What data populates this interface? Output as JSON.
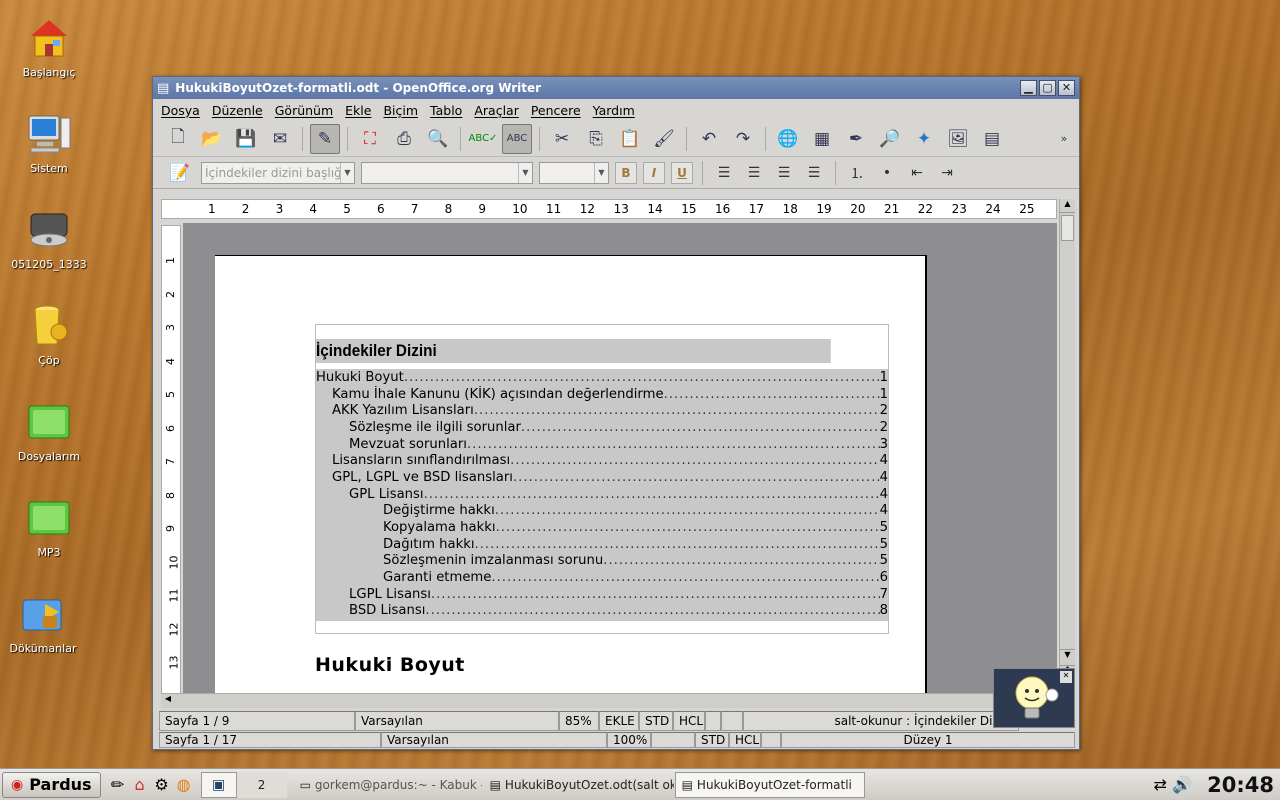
{
  "desktop": {
    "icons": [
      {
        "label": "Başlangıç"
      },
      {
        "label": "Sistem"
      },
      {
        "label": "051205_1333"
      },
      {
        "label": "Çöp"
      },
      {
        "label": "Dosyalarım"
      },
      {
        "label": "MP3"
      },
      {
        "label": "Dökümanlar"
      }
    ]
  },
  "window": {
    "title": "HukukiBoyutOzet-formatli.odt - OpenOffice.org Writer",
    "controls": {
      "minimize": "▁",
      "maximize": "▢",
      "close": "✕"
    }
  },
  "menu": [
    "Dosya",
    "Düzenle",
    "Görünüm",
    "Ekle",
    "Biçim",
    "Tablo",
    "Araçlar",
    "Pencere",
    "Yardım"
  ],
  "format_toolbar": {
    "style_value": "İçindekiler dizini başlığı",
    "bold": "B",
    "italic": "I",
    "underline": "U"
  },
  "ruler": {
    "h_ticks": [
      "1",
      "2",
      "3",
      "4",
      "5",
      "6",
      "7",
      "8",
      "9",
      "10",
      "11",
      "12",
      "13",
      "14",
      "15",
      "16",
      "17",
      "18",
      "19",
      "20",
      "21",
      "22",
      "23",
      "24",
      "25"
    ],
    "v_ticks": [
      "1",
      "2",
      "3",
      "4",
      "5",
      "6",
      "7",
      "8",
      "9",
      "10",
      "11",
      "12",
      "13"
    ]
  },
  "document": {
    "toc_title": "İçindekiler Dizini",
    "toc_entries": [
      {
        "label": "Hukuki Boyut",
        "page": "1",
        "level": 0
      },
      {
        "label": "Kamu İhale Kanunu (KİK) açısından değerlendirme",
        "page": "1",
        "level": 1
      },
      {
        "label": "AKK Yazılım Lisansları",
        "page": "2",
        "level": 1
      },
      {
        "label": "Sözleşme ile ilgili sorunlar",
        "page": "2",
        "level": 2
      },
      {
        "label": "Mevzuat sorunları",
        "page": "3",
        "level": 2
      },
      {
        "label": "Lisansların sınıflandırılması",
        "page": "4",
        "level": 1
      },
      {
        "label": "GPL, LGPL ve BSD lisansları ",
        "page": "4",
        "level": 1
      },
      {
        "label": "GPL Lisansı",
        "page": "4",
        "level": 2
      },
      {
        "label": "Değiştirme hakkı",
        "page": "4",
        "level": 4
      },
      {
        "label": "Kopyalama hakkı",
        "page": "5",
        "level": 4
      },
      {
        "label": "Dağıtım hakkı",
        "page": "5",
        "level": 4
      },
      {
        "label": "Sözleşmenin imzalanması sorunu",
        "page": "5",
        "level": 4
      },
      {
        "label": "Garanti etmeme",
        "page": "6",
        "level": 4
      },
      {
        "label": "LGPL Lisansı",
        "page": "7",
        "level": 2
      },
      {
        "label": "BSD Lisansı",
        "page": "8",
        "level": 2
      }
    ],
    "heading1": "Hukuki Boyut"
  },
  "status": {
    "page": "Sayfa 1 / 9",
    "style": "Varsayılan",
    "zoom": "85%",
    "insert": "EKLE",
    "std": "STD",
    "hcl": "HCL",
    "readonly": "salt-okunur : İçindekiler Dizini"
  },
  "status2": {
    "page": "Sayfa 1 / 17",
    "style": "Varsayılan",
    "zoom": "100%",
    "std": "STD",
    "hcl": "HCL",
    "level": "Düzey 1"
  },
  "taskbar": {
    "start": "Pardus",
    "desktop_num": "2",
    "tasks": [
      {
        "label": "gorkem@pardus:~ - Kabuk - K"
      },
      {
        "label": "HukukiBoyutOzet.odt(salt oku"
      },
      {
        "label": "HukukiBoyutOzet-formatli"
      }
    ],
    "clock": "20:48"
  }
}
